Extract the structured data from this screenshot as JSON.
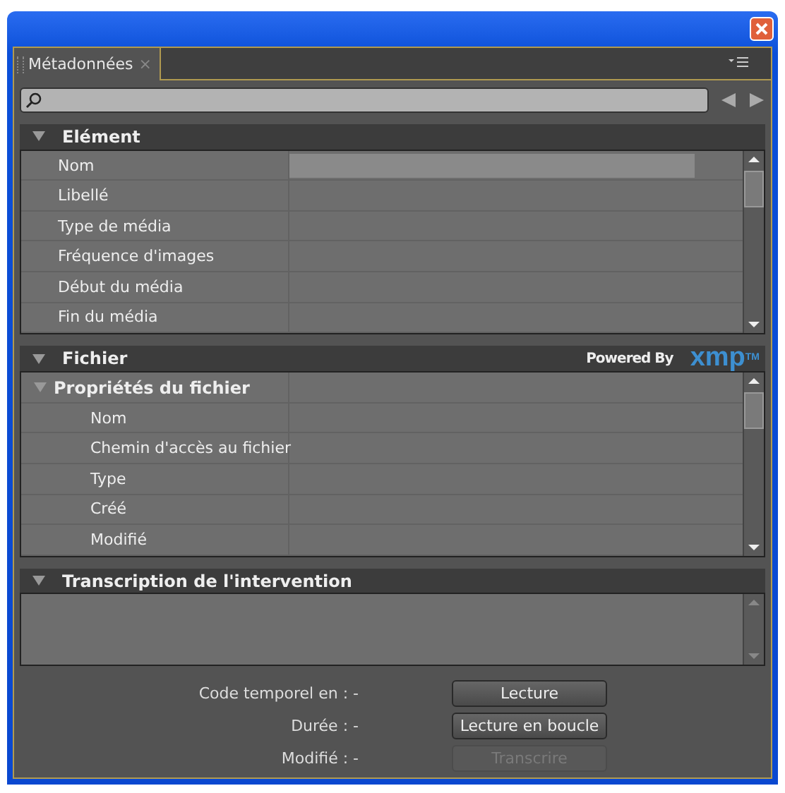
{
  "tabs": [
    {
      "label": "Métadonnées",
      "close": "×",
      "selected": true
    }
  ],
  "sections": [
    {
      "title": "Elément",
      "expanded": true,
      "rows": [
        {
          "label": "Nom",
          "kind": "field"
        },
        {
          "label": "Libellé",
          "kind": "plain"
        },
        {
          "label": "Type de média",
          "kind": "plain"
        },
        {
          "label": "Fréquence d'images",
          "kind": "plain"
        },
        {
          "label": "Début du média",
          "kind": "plain"
        },
        {
          "label": "Fin du média",
          "kind": "plain"
        }
      ]
    },
    {
      "title": "Fichier",
      "expanded": true,
      "powered_by": "Powered By",
      "logo": "xmp",
      "logo_mark": "TM",
      "group": {
        "title": "Propriétés du fichier",
        "expanded": true,
        "rows": [
          {
            "label": "Nom"
          },
          {
            "label": "Chemin d'accès au fichier"
          },
          {
            "label": "Type"
          },
          {
            "label": "Créé"
          },
          {
            "label": "Modifié"
          }
        ]
      }
    },
    {
      "title": "Transcription de l'intervention",
      "expanded": true
    }
  ],
  "footer": [
    {
      "label": "Code temporel en : -",
      "button": "Lecture",
      "disabled": false
    },
    {
      "label": "Durée : -",
      "button": "Lecture en boucle",
      "disabled": false
    },
    {
      "label": "Modifié : -",
      "button": "Transcrire",
      "disabled": true
    }
  ]
}
